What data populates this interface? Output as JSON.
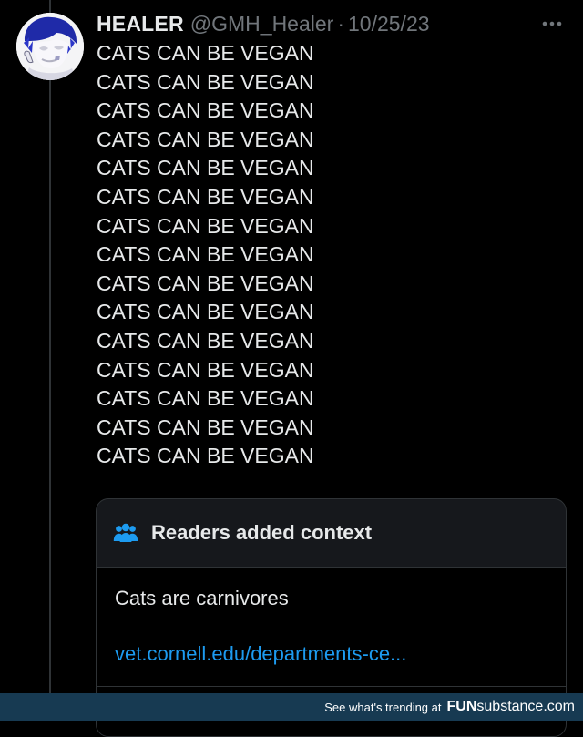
{
  "tweet": {
    "display_name": "HEALER",
    "handle": "@GMH_Healer",
    "separator": "·",
    "date": "10/25/23",
    "lines": [
      "CATS CAN BE VEGAN",
      "CATS CAN BE VEGAN",
      "CATS CAN BE VEGAN",
      "CATS CAN BE VEGAN",
      "CATS CAN BE VEGAN",
      "CATS CAN BE VEGAN",
      "CATS CAN BE VEGAN",
      "CATS CAN BE VEGAN",
      "CATS CAN BE VEGAN",
      "CATS CAN BE VEGAN",
      "CATS CAN BE VEGAN",
      "CATS CAN BE VEGAN",
      "CATS CAN BE VEGAN",
      "CATS CAN BE VEGAN",
      "CATS CAN BE VEGAN"
    ]
  },
  "context_note": {
    "title": "Readers added context",
    "note": "Cats are carnivores",
    "link": "vet.cornell.edu/departments-ce..."
  },
  "footer": {
    "text": "See what's trending at",
    "brand_fun": "FUN",
    "brand_sub": "substance",
    "brand_com": ".com"
  },
  "icons": {
    "more": "more-horizontal-icon",
    "context": "people-icon"
  },
  "colors": {
    "background": "#000000",
    "text": "#e7e9ea",
    "muted": "#71767b",
    "link": "#1d9bf0",
    "card": "#16181c",
    "footer": "#173a52"
  }
}
